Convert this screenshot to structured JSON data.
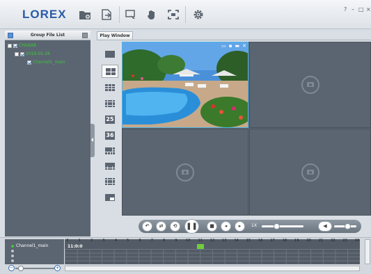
{
  "app": {
    "logo": "LOREX"
  },
  "toolbar": {
    "icons": [
      "folder-icon",
      "export-icon",
      "screenshot-icon",
      "hand-icon",
      "fullscreen-icon",
      "settings-gear-icon"
    ],
    "help": "?",
    "minimize": "–",
    "maximize": "□",
    "close": "×"
  },
  "left_panel": {
    "title": "Group File List",
    "tree": [
      {
        "label": "Child\\A8",
        "level": 0
      },
      {
        "label": "2019-05-28",
        "level": 1
      },
      {
        "label": "Channel1_main",
        "level": 2
      }
    ]
  },
  "play_window": {
    "tab_label": "Play Window",
    "layouts": [
      "1",
      "4",
      "9",
      "16",
      "25",
      "36",
      "8",
      "10",
      "13",
      "picture-in-picture"
    ],
    "active_layout": "4",
    "cell_bar_icons": [
      "chat-icon",
      "camera-icon",
      "record-icon",
      "close-icon"
    ],
    "cell_close": "✕"
  },
  "controls": {
    "speed": "1X",
    "volume": 0.6,
    "speed_level": 0.35
  },
  "timeline": {
    "channel": "Channel1_main",
    "current_time": "11:0:0",
    "hours": [
      "0",
      "1",
      "2",
      "3",
      "4",
      "5",
      "6",
      "7",
      "8",
      "9",
      "10",
      "11",
      "12",
      "13",
      "14",
      "15",
      "16",
      "17",
      "18",
      "19",
      "20",
      "21",
      "22",
      "23",
      "24"
    ]
  },
  "colors": {
    "accent": "#2a5aa8",
    "tree_green": "#3ec63a",
    "panel": "#5b6571",
    "selected_border": "#4ab3e6",
    "record_bar": "#6fcf3a"
  }
}
